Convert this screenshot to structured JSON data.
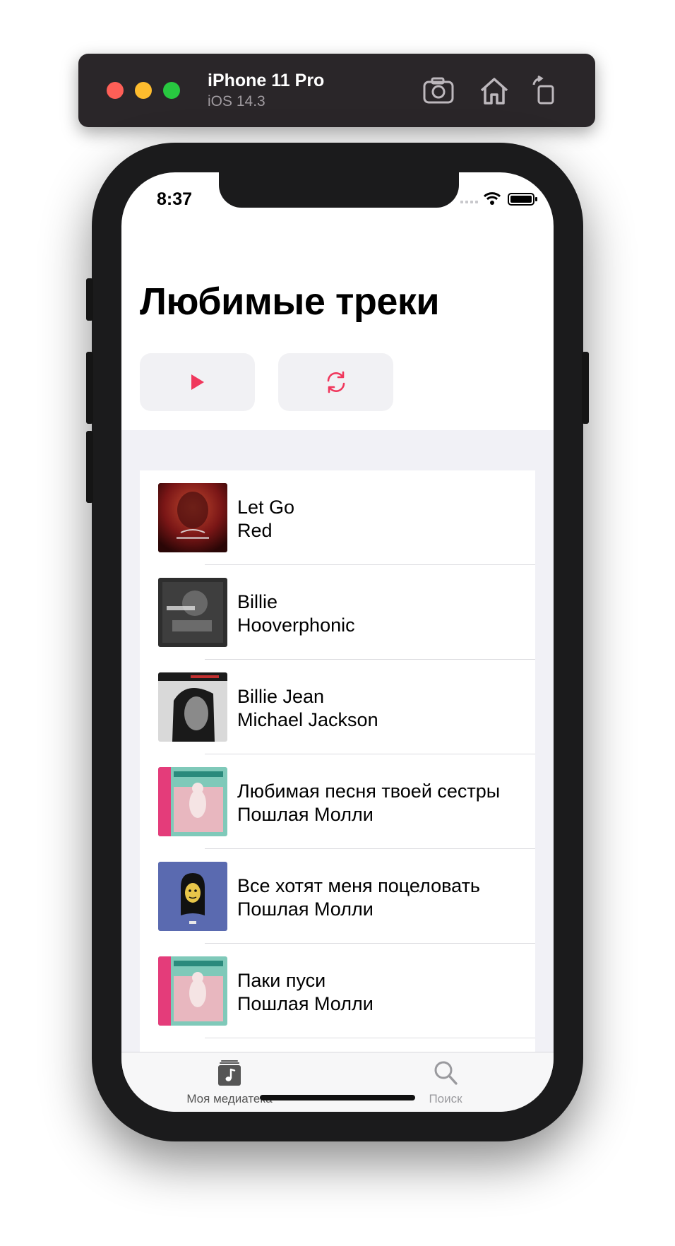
{
  "simulator": {
    "device_name": "iPhone 11 Pro",
    "os_version": "iOS 14.3",
    "buttons": [
      "screenshot-icon",
      "home-icon",
      "rotate-icon"
    ]
  },
  "status_bar": {
    "time": "8:37"
  },
  "page": {
    "title": "Любимые треки",
    "play_icon": "play-icon",
    "shuffle_icon": "shuffle-icon",
    "accent_color": "#f0375c"
  },
  "tracks": [
    {
      "title": "Let Go",
      "artist": "Red"
    },
    {
      "title": "Billie",
      "artist": "Hooverphonic"
    },
    {
      "title": "Billie Jean",
      "artist": "Michael Jackson"
    },
    {
      "title": "Любимая песня твоей сестры",
      "artist": "Пошлая Молли"
    },
    {
      "title": "Все хотят меня поцеловать",
      "artist": "Пошлая Молли"
    },
    {
      "title": "Паки пуси",
      "artist": "Пошлая Молли"
    }
  ],
  "tabbar": {
    "library_label": "Моя медиатека",
    "search_label": "Поиск"
  }
}
